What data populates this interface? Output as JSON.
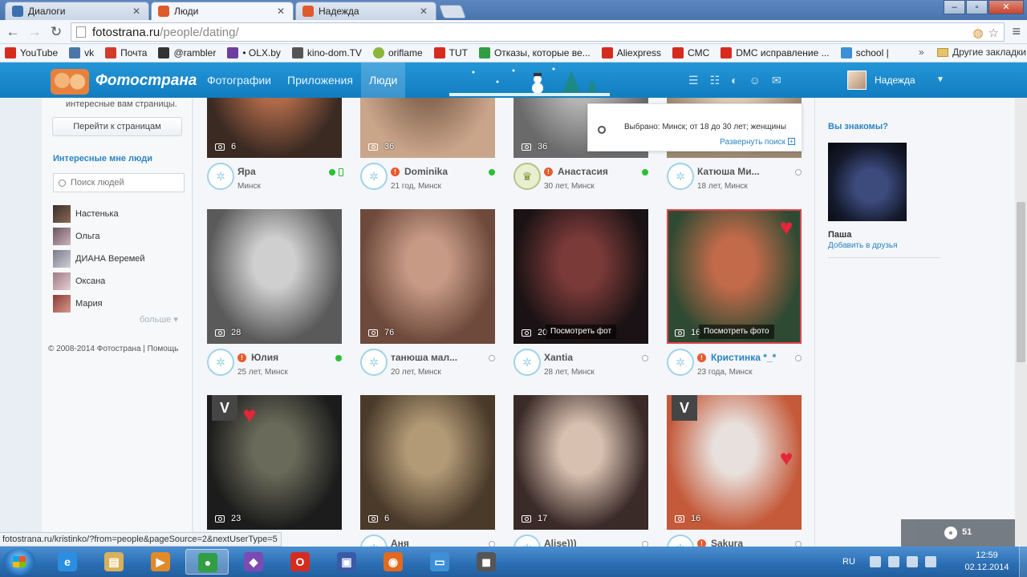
{
  "browser": {
    "tabs": [
      {
        "label": "Диалоги",
        "color": "#3a6fb0",
        "active": false
      },
      {
        "label": "Люди",
        "color": "#e05a2b",
        "active": true
      },
      {
        "label": "Надежда",
        "color": "#e05a2b",
        "active": false
      }
    ],
    "url_host": "fotostrana.ru",
    "url_path": "/people/dating/",
    "bookmarks": [
      {
        "label": "YouTube",
        "color": "#d62b1f"
      },
      {
        "label": "vk",
        "color": "#4a76a8"
      },
      {
        "label": "Почта",
        "color": "#d23b2c"
      },
      {
        "label": "@rambler",
        "color": "#333333"
      },
      {
        "label": "• OLX.by",
        "color": "#6b3fa0"
      },
      {
        "label": "kino-dom.TV",
        "color": "#555555"
      },
      {
        "label": "oriflame",
        "color": "#8ab63a"
      },
      {
        "label": "TUT",
        "color": "#d62b1f"
      },
      {
        "label": "Отказы, которые ве...",
        "color": "#2f9e44"
      },
      {
        "label": "Aliexpress",
        "color": "#d62b1f"
      },
      {
        "label": "СМС",
        "color": "#d62b1f"
      },
      {
        "label": "DMC исправление ...",
        "color": "#d62b1f"
      },
      {
        "label": "school |",
        "color": "#3d8fd8"
      }
    ],
    "bookmarks_more": "»",
    "other_bookmarks": "Другие закладки"
  },
  "site": {
    "logo": "Фотострана",
    "nav": [
      {
        "label": "Фотографии",
        "active": false
      },
      {
        "label": "Приложения",
        "active": false
      },
      {
        "label": "Люди",
        "active": true
      }
    ],
    "user_name": "Надежда"
  },
  "left": {
    "top_text": "интересные вам страницы.",
    "goto_button": "Перейти к страницам",
    "interesting_heading": "Интересные мне люди",
    "search_placeholder": "Поиск людей",
    "friends": [
      {
        "name": "Настенька",
        "color": "#3a2e28"
      },
      {
        "name": "Ольга",
        "color": "#6a5460"
      },
      {
        "name": "ДИАНА Веремей",
        "color": "#7a7a88"
      },
      {
        "name": "Оксана",
        "color": "#a07a82"
      },
      {
        "name": "Мария",
        "color": "#8a3a3a"
      }
    ],
    "more": "больше",
    "footer": "© 2008-2014 Фотострана | Помощь"
  },
  "search_popup": {
    "text": "Выбрано: Минск; от 18 до 30 лет; женщины",
    "expand_link": "Развернуть поиск"
  },
  "cards": [
    {
      "name": "Яра",
      "meta": "Минск",
      "photos": "6",
      "status": "online",
      "phone": true,
      "warn": false,
      "level": "normal",
      "link": false,
      "bg": "#3a2a22",
      "bg2": "#b06a4a"
    },
    {
      "name": "Dominika",
      "meta": "21 год, Минск",
      "photos": "36",
      "status": "online",
      "phone": false,
      "warn": true,
      "level": "normal",
      "link": false,
      "bg": "#c9a58a",
      "bg2": "#8a6a55"
    },
    {
      "name": "Анастасия",
      "meta": "30 лет, Минск",
      "photos": "36",
      "status": "online",
      "phone": false,
      "warn": true,
      "level": "crown",
      "link": false,
      "bg": "#6a6a6a",
      "bg2": "#b4b4b4"
    },
    {
      "name": "Катюша Ми...",
      "meta": "18 лет, Минск",
      "photos": "",
      "status": "offline",
      "phone": false,
      "warn": false,
      "level": "normal",
      "link": false,
      "bg": "#9a8870",
      "bg2": "#d8cab5"
    },
    {
      "name": "Юлия",
      "meta": "25 лет, Минск",
      "photos": "28",
      "status": "online",
      "phone": false,
      "warn": true,
      "level": "normal",
      "link": false,
      "bg": "#5a5a5a",
      "bg2": "#cfcfcf"
    },
    {
      "name": "танюша мал...",
      "meta": "20 лет, Минск",
      "photos": "76",
      "status": "offline",
      "phone": false,
      "warn": false,
      "level": "normal",
      "link": false,
      "bg": "#6e4a3c",
      "bg2": "#c79a86"
    },
    {
      "name": "Xantia",
      "meta": "28 лет, Минск",
      "photos": "20",
      "status": "offline",
      "phone": false,
      "warn": false,
      "level": "normal",
      "link": false,
      "bg": "#1a1214",
      "bg2": "#7a3a38",
      "view": "Посмотреть фот"
    },
    {
      "name": "Кристинка *_*",
      "meta": "23 года, Минск",
      "photos": "16",
      "status": "offline",
      "phone": false,
      "warn": true,
      "level": "normal",
      "link": true,
      "bg": "#2f4a32",
      "bg2": "#c26a4a",
      "view": "Посмотреть фото",
      "heart": true,
      "border": "#e0454d"
    },
    {
      "name": "",
      "meta": "",
      "photos": "23",
      "status": "",
      "phone": false,
      "warn": false,
      "level": "none",
      "link": false,
      "bg": "#1c1c1c",
      "bg2": "#6a6a5a",
      "vip": "V",
      "heart_left": true
    },
    {
      "name": "Аня",
      "meta": "",
      "photos": "6",
      "status": "offline",
      "phone": false,
      "warn": false,
      "level": "normal",
      "link": false,
      "bg": "#4a3a2a",
      "bg2": "#b29a76"
    },
    {
      "name": "Alise)))",
      "meta": "",
      "photos": "17",
      "status": "offline",
      "phone": false,
      "warn": false,
      "level": "normal",
      "link": false,
      "bg": "#3a2a28",
      "bg2": "#d8c0b0"
    },
    {
      "name": "Sakura",
      "meta": "",
      "photos": "16",
      "status": "offline",
      "phone": false,
      "warn": true,
      "level": "normal",
      "link": false,
      "bg": "#c45a3a",
      "bg2": "#e8e0dc",
      "vip": "V",
      "heart": true
    }
  ],
  "right": {
    "heading": "Вы знакомы?",
    "person_name": "Паша",
    "add_friend": "Добавить в друзья"
  },
  "notifications_count": "51",
  "status_url": "fotostrana.ru/kristinko/?from=people&pageSource=2&nextUserType=5",
  "taskbar": {
    "apps": [
      {
        "name": "internet-explorer",
        "color": "#2a8fe0",
        "glyph": "e",
        "active": false
      },
      {
        "name": "file-explorer",
        "color": "#d9b15a",
        "glyph": "▤",
        "active": false
      },
      {
        "name": "media-player",
        "color": "#e08a2a",
        "glyph": "▶",
        "active": false
      },
      {
        "name": "chrome",
        "color": "#2f9e44",
        "glyph": "●",
        "active": true
      },
      {
        "name": "visual-studio",
        "color": "#7b4ab5",
        "glyph": "◆",
        "active": false
      },
      {
        "name": "opera",
        "color": "#d62b1f",
        "glyph": "O",
        "active": false
      },
      {
        "name": "save-app",
        "color": "#3a5aa8",
        "glyph": "▣",
        "active": false
      },
      {
        "name": "firefox",
        "color": "#e06a1f",
        "glyph": "◉",
        "active": false
      },
      {
        "name": "remote-desktop",
        "color": "#3d8fd8",
        "glyph": "▭",
        "active": false
      },
      {
        "name": "camera-app",
        "color": "#555555",
        "glyph": "◼",
        "active": false
      }
    ],
    "lang": "RU",
    "time": "12:59",
    "date": "02.12.2014"
  }
}
